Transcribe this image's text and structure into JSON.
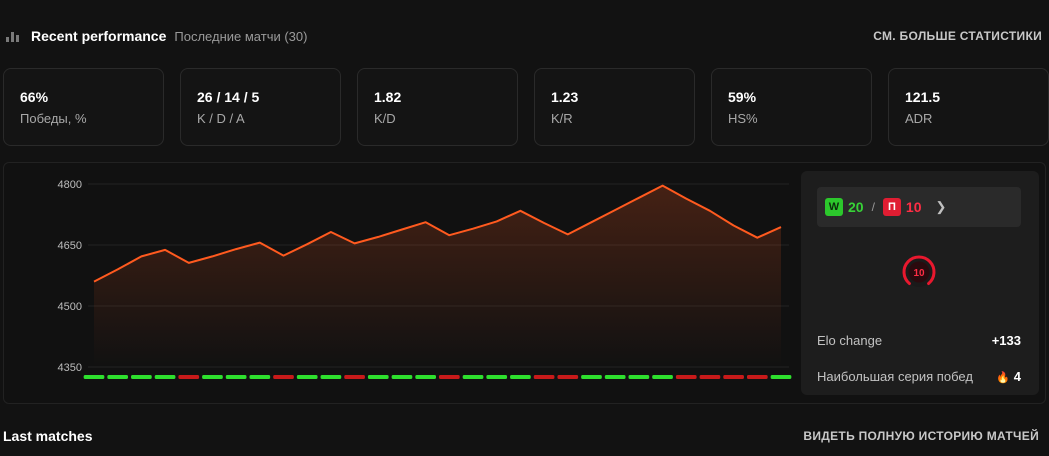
{
  "header": {
    "icon": "bar-chart-icon",
    "title": "Recent performance",
    "subtitle": "Последние матчи (30)",
    "more_link": "СМ. БОЛЬШЕ СТАТИСТИКИ"
  },
  "stats": [
    {
      "value": "66%",
      "label": "Победы, %"
    },
    {
      "value": "26 / 14 / 5",
      "label": "K / D / A"
    },
    {
      "value": "1.82",
      "label": "K/D"
    },
    {
      "value": "1.23",
      "label": "K/R"
    },
    {
      "value": "59%",
      "label": "HS%"
    },
    {
      "value": "121.5",
      "label": "ADR"
    }
  ],
  "chart_data": {
    "type": "area",
    "title": "",
    "xlabel": "",
    "ylabel": "",
    "ylim": [
      4350,
      4800
    ],
    "yticks": [
      "4800",
      "4650",
      "4500",
      "4350"
    ],
    "grid": true,
    "line_color": "#ff5a1f",
    "values": [
      4560,
      4590,
      4622,
      4638,
      4606,
      4622,
      4640,
      4656,
      4624,
      4652,
      4682,
      4654,
      4670,
      4688,
      4706,
      4674,
      4690,
      4708,
      4734,
      4704,
      4676,
      4706,
      4736,
      4766,
      4796,
      4764,
      4734,
      4698,
      4668,
      4694
    ],
    "results": [
      "W",
      "W",
      "W",
      "W",
      "L",
      "W",
      "W",
      "W",
      "L",
      "W",
      "W",
      "L",
      "W",
      "W",
      "W",
      "L",
      "W",
      "W",
      "W",
      "L",
      "L",
      "W",
      "W",
      "W",
      "W",
      "L",
      "L",
      "L",
      "L",
      "W"
    ],
    "win_color": "#2ee02e",
    "loss_color": "#c81a1a"
  },
  "summary": {
    "wins": "20",
    "wins_badge": "W",
    "losses": "10",
    "losses_badge": "П",
    "separator": "/",
    "level": "10",
    "elo_label": "Elo change",
    "elo_value": "+133",
    "streak_label": "Наибольшая серия побед",
    "streak_value": "4"
  },
  "footer": {
    "title": "Last matches",
    "link": "ВИДЕТЬ ПОЛНУЮ ИСТОРИЮ МАТЧЕЙ"
  }
}
